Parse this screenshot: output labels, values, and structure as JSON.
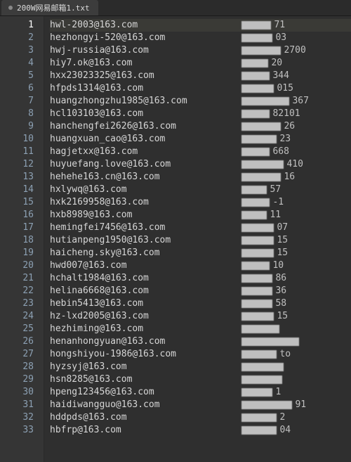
{
  "tab": {
    "title": "200W网易邮箱1.txt"
  },
  "active_line": 1,
  "rows": [
    {
      "n": 1,
      "email": "hwl-2003@163.com",
      "blur_w": 42,
      "tail": "71"
    },
    {
      "n": 2,
      "email": "hezhongyi-520@163.com",
      "blur_w": 44,
      "tail": "03"
    },
    {
      "n": 3,
      "email": "hwj-russia@163.com",
      "blur_w": 56,
      "tail": "2700"
    },
    {
      "n": 4,
      "email": "hiy7.ok@163.com",
      "blur_w": 38,
      "tail": "20"
    },
    {
      "n": 5,
      "email": "hxx23023325@163.com",
      "blur_w": 40,
      "tail": "344"
    },
    {
      "n": 6,
      "email": "hfpds1314@163.com",
      "blur_w": 46,
      "tail": "015"
    },
    {
      "n": 7,
      "email": "huangzhongzhu1985@163.com",
      "blur_w": 68,
      "tail": "367"
    },
    {
      "n": 8,
      "email": "hcl103103@163.com",
      "blur_w": 40,
      "tail": "82101"
    },
    {
      "n": 9,
      "email": "hanchengfei2626@163.com",
      "blur_w": 56,
      "tail": "26"
    },
    {
      "n": 10,
      "email": "huangxuan_cao@163.com",
      "blur_w": 50,
      "tail": "23"
    },
    {
      "n": 11,
      "email": "hagjetxx@163.com",
      "blur_w": 40,
      "tail": "668"
    },
    {
      "n": 12,
      "email": "huyuefang.love@163.com",
      "blur_w": 60,
      "tail": "410"
    },
    {
      "n": 13,
      "email": "hehehe163.cn@163.com",
      "blur_w": 56,
      "tail": "16"
    },
    {
      "n": 14,
      "email": "hxlywq@163.com",
      "blur_w": 36,
      "tail": "57"
    },
    {
      "n": 15,
      "email": "hxk2169958@163.com",
      "blur_w": 40,
      "tail": "-1"
    },
    {
      "n": 16,
      "email": "hxb8989@163.com",
      "blur_w": 36,
      "tail": "11"
    },
    {
      "n": 17,
      "email": "hemingfei7456@163.com",
      "blur_w": 46,
      "tail": "07"
    },
    {
      "n": 18,
      "email": "hutianpeng1950@163.com",
      "blur_w": 46,
      "tail": "15"
    },
    {
      "n": 19,
      "email": "haicheng.sky@163.com",
      "blur_w": 46,
      "tail": "15"
    },
    {
      "n": 20,
      "email": "hwd007@163.com",
      "blur_w": 40,
      "tail": "10"
    },
    {
      "n": 21,
      "email": "hchalt1984@163.com",
      "blur_w": 44,
      "tail": "86"
    },
    {
      "n": 22,
      "email": "helina6668@163.com",
      "blur_w": 44,
      "tail": "36"
    },
    {
      "n": 23,
      "email": "hebin5413@163.com",
      "blur_w": 44,
      "tail": "58"
    },
    {
      "n": 24,
      "email": "hz-lxd2005@163.com",
      "blur_w": 46,
      "tail": "15"
    },
    {
      "n": 25,
      "email": "hezhiming@163.com",
      "blur_w": 54,
      "tail": ""
    },
    {
      "n": 26,
      "email": "henanhongyuan@163.com",
      "blur_w": 82,
      "tail": ""
    },
    {
      "n": 27,
      "email": "hongshiyou-1986@163.com",
      "blur_w": 50,
      "tail": "to"
    },
    {
      "n": 28,
      "email": "hyzsyj@163.com",
      "blur_w": 60,
      "tail": ""
    },
    {
      "n": 29,
      "email": "hsn8285@163.com",
      "blur_w": 58,
      "tail": ""
    },
    {
      "n": 30,
      "email": "hpeng123456@163.com",
      "blur_w": 44,
      "tail": "1"
    },
    {
      "n": 31,
      "email": "haidiwangguo@163.com",
      "blur_w": 72,
      "tail": "91"
    },
    {
      "n": 32,
      "email": "hddpds@163.com",
      "blur_w": 50,
      "tail": "2"
    },
    {
      "n": 33,
      "email": "hbfrp@163.com",
      "blur_w": 50,
      "tail": "04"
    }
  ]
}
